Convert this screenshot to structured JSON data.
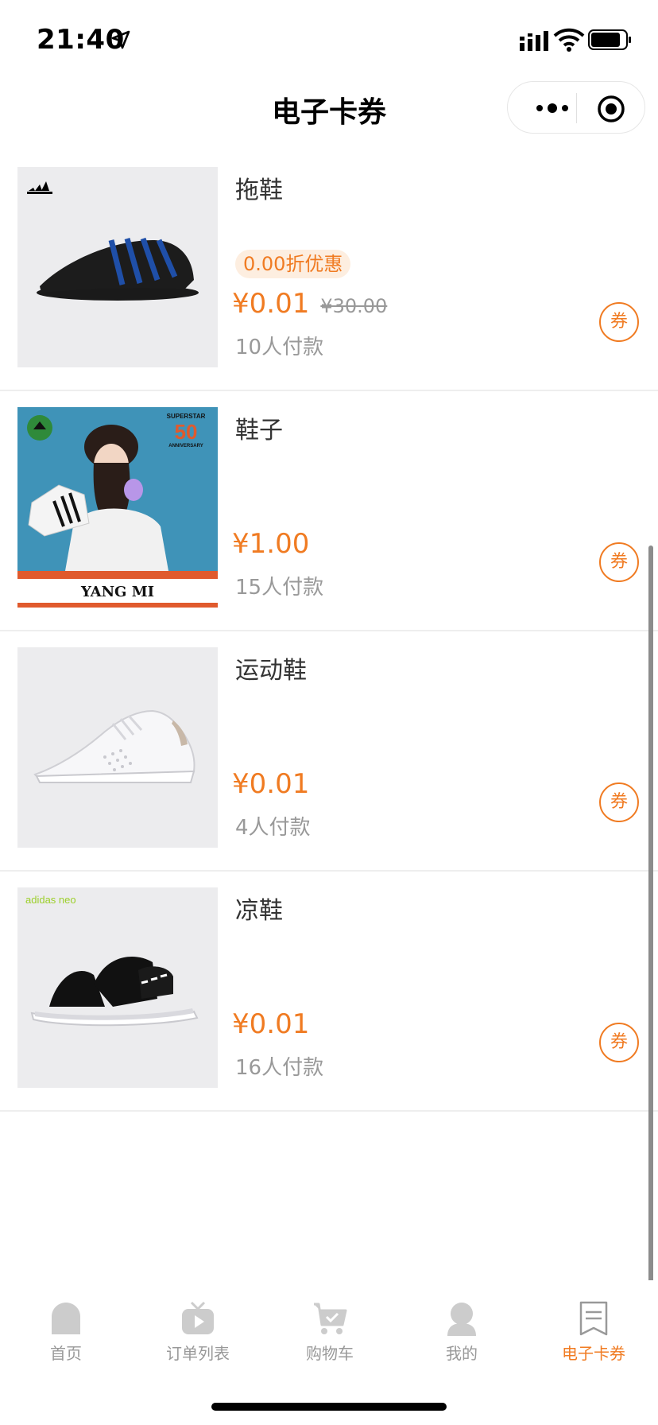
{
  "status_bar": {
    "time": "21:40"
  },
  "nav": {
    "title": "电子卡券"
  },
  "items": [
    {
      "title": "拖鞋",
      "discount": "0.00折优惠",
      "price": "¥0.01",
      "original_price": "¥30.00",
      "paid": "10人付款",
      "coupon_label": "券"
    },
    {
      "title": "鞋子",
      "price": "¥1.00",
      "paid": "15人付款",
      "coupon_label": "券",
      "image_text": {
        "badge_top": "SUPERSTAR",
        "badge_num": "50",
        "badge_bottom": "ANNIVERSARY",
        "caption": "YANG MI"
      }
    },
    {
      "title": "运动鞋",
      "price": "¥0.01",
      "paid": "4人付款",
      "coupon_label": "券"
    },
    {
      "title": "凉鞋",
      "price": "¥0.01",
      "paid": "16人付款",
      "coupon_label": "券",
      "image_text": {
        "brand": "adidas neo"
      }
    }
  ],
  "tabbar": {
    "tabs": [
      {
        "label": "首页",
        "icon": "home-icon",
        "active": false
      },
      {
        "label": "订单列表",
        "icon": "tv-icon",
        "active": false
      },
      {
        "label": "购物车",
        "icon": "cart-icon",
        "active": false
      },
      {
        "label": "我的",
        "icon": "user-icon",
        "active": false
      },
      {
        "label": "电子卡券",
        "icon": "coupon-icon",
        "active": true
      }
    ]
  },
  "colors": {
    "accent": "#f07b22",
    "muted": "#999999",
    "tab_inactive": "#cccccc"
  }
}
